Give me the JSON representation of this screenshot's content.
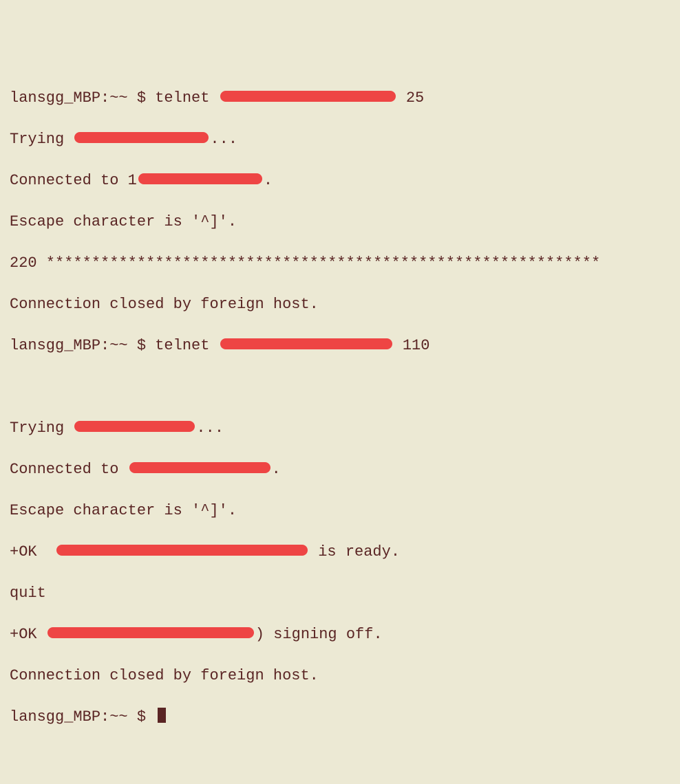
{
  "prompt1_prefix": "lansgg_MBP:~~ $ telnet ",
  "prompt1_suffix": " 25",
  "trying_prefix": "Trying ",
  "trying_suffix": "...",
  "connected1_prefix": "Connected to 1",
  "connected1_suffix": ".",
  "escape": "Escape character is '^]'.",
  "banner220": "220 *************************************************************",
  "closed": "Connection closed by foreign host.",
  "prompt2_prefix": "lansgg_MBP:~~ $ telnet ",
  "prompt2_suffix": " 110",
  "connected2_prefix": "Connected to ",
  "connected2_suffix": ".",
  "ok_ready_prefix": "+OK  ",
  "ok_ready_suffix": " is ready.",
  "quit": "quit",
  "ok_off_prefix": "+OK ",
  "ok_off_suffix": ") signing off.",
  "prompt3": "lansgg_MBP:~~ $ ",
  "redact_widths": {
    "w1": 255,
    "w2": 195,
    "w3": 180,
    "w4": 250,
    "w5": 175,
    "w6": 205,
    "w7": 365,
    "w8": 300
  }
}
